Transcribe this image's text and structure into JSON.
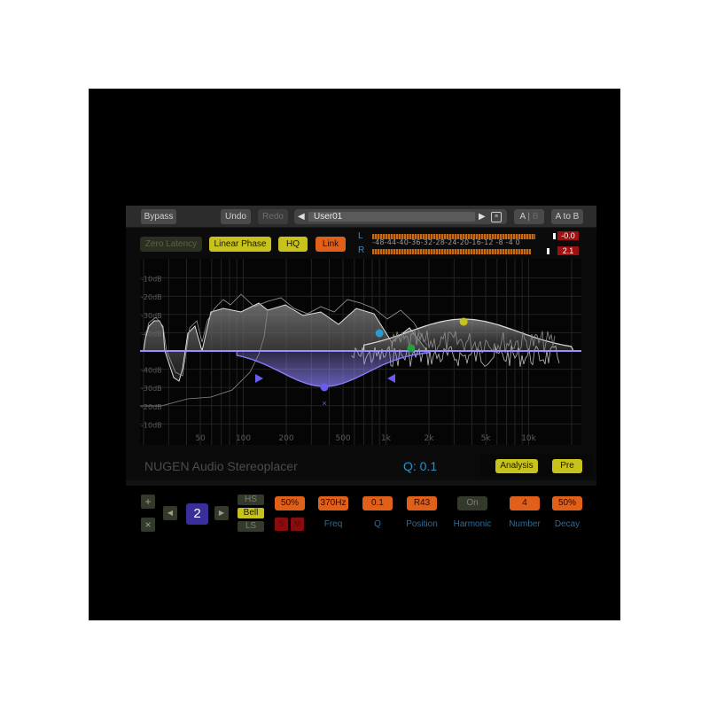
{
  "app": {
    "name": "NUGEN Audio Stereoplacer"
  },
  "toolbar": {
    "bypass": "Bypass",
    "undo": "Undo",
    "redo": "Redo",
    "preset_prev_icon": "triangle-left",
    "preset_name": "User01",
    "preset_next_icon": "triangle-right",
    "preset_list_icon": "list",
    "ab_a": "A",
    "ab_sep": "|",
    "ab_b": "B",
    "a_to_b": "A to B"
  },
  "options": {
    "zero_latency": {
      "label": "Zero Latency",
      "active": false
    },
    "linear_phase": {
      "label": "Linear Phase",
      "active": true
    },
    "hq": {
      "label": "HQ",
      "active": true
    },
    "link": {
      "label": "Link",
      "active": true
    }
  },
  "meters": {
    "left_label": "L",
    "right_label": "R",
    "scale": "-48-44-40-36-32-28-24-20-16-12 -8  -4  0",
    "left_peak": "-0.0",
    "right_peak": "2.1",
    "left_level_fraction": 0.98,
    "right_level_fraction": 0.95
  },
  "graph": {
    "db_labels_top": [
      "-10dB",
      "-20dB",
      "-30dB",
      "-40dB"
    ],
    "db_labels_bottom": [
      "-40dB",
      "-30dB",
      "-20dB",
      "-10dB"
    ],
    "freq_labels": [
      "50",
      "100",
      "200",
      "500",
      "1k",
      "2k",
      "5k",
      "10k"
    ],
    "freq_values": [
      50,
      100,
      200,
      500,
      1000,
      2000,
      5000,
      10000
    ],
    "freq_range_hz": [
      20,
      20000
    ],
    "selected_band": {
      "freq_hz": 370,
      "q": 0.1,
      "color": "#6a5cf0"
    },
    "bands": [
      {
        "freq_hz": 900,
        "color": "#2a9ad0"
      },
      {
        "freq_hz": 1500,
        "color": "#23a040"
      },
      {
        "freq_hz": 3500,
        "color": "#c8c21c"
      }
    ],
    "colors": {
      "eq_curve": "#8a80ff",
      "spectrum": "#d0d0d0",
      "grid": "#262626"
    }
  },
  "info": {
    "title": "NUGEN Audio Stereoplacer",
    "q_readout": "Q: 0.1",
    "analysis": "Analysis",
    "pre": "Pre"
  },
  "band_controls": {
    "add_icon": "+",
    "remove_icon": "×",
    "prev_icon": "◀",
    "next_icon": "▶",
    "band_number": "2",
    "shapes": [
      {
        "label": "HS",
        "active": false
      },
      {
        "label": "Bell",
        "active": true
      },
      {
        "label": "LS",
        "active": false
      }
    ],
    "gain": "50%",
    "solo": "S",
    "mute": "M",
    "params": [
      {
        "value": "370Hz",
        "label": "Freq"
      },
      {
        "value": "0.1",
        "label": "Q"
      },
      {
        "value": "R43",
        "label": "Position"
      },
      {
        "value": "On",
        "label": "Harmonic"
      },
      {
        "value": "4",
        "label": "Number"
      },
      {
        "value": "50%",
        "label": "Decay"
      }
    ]
  }
}
